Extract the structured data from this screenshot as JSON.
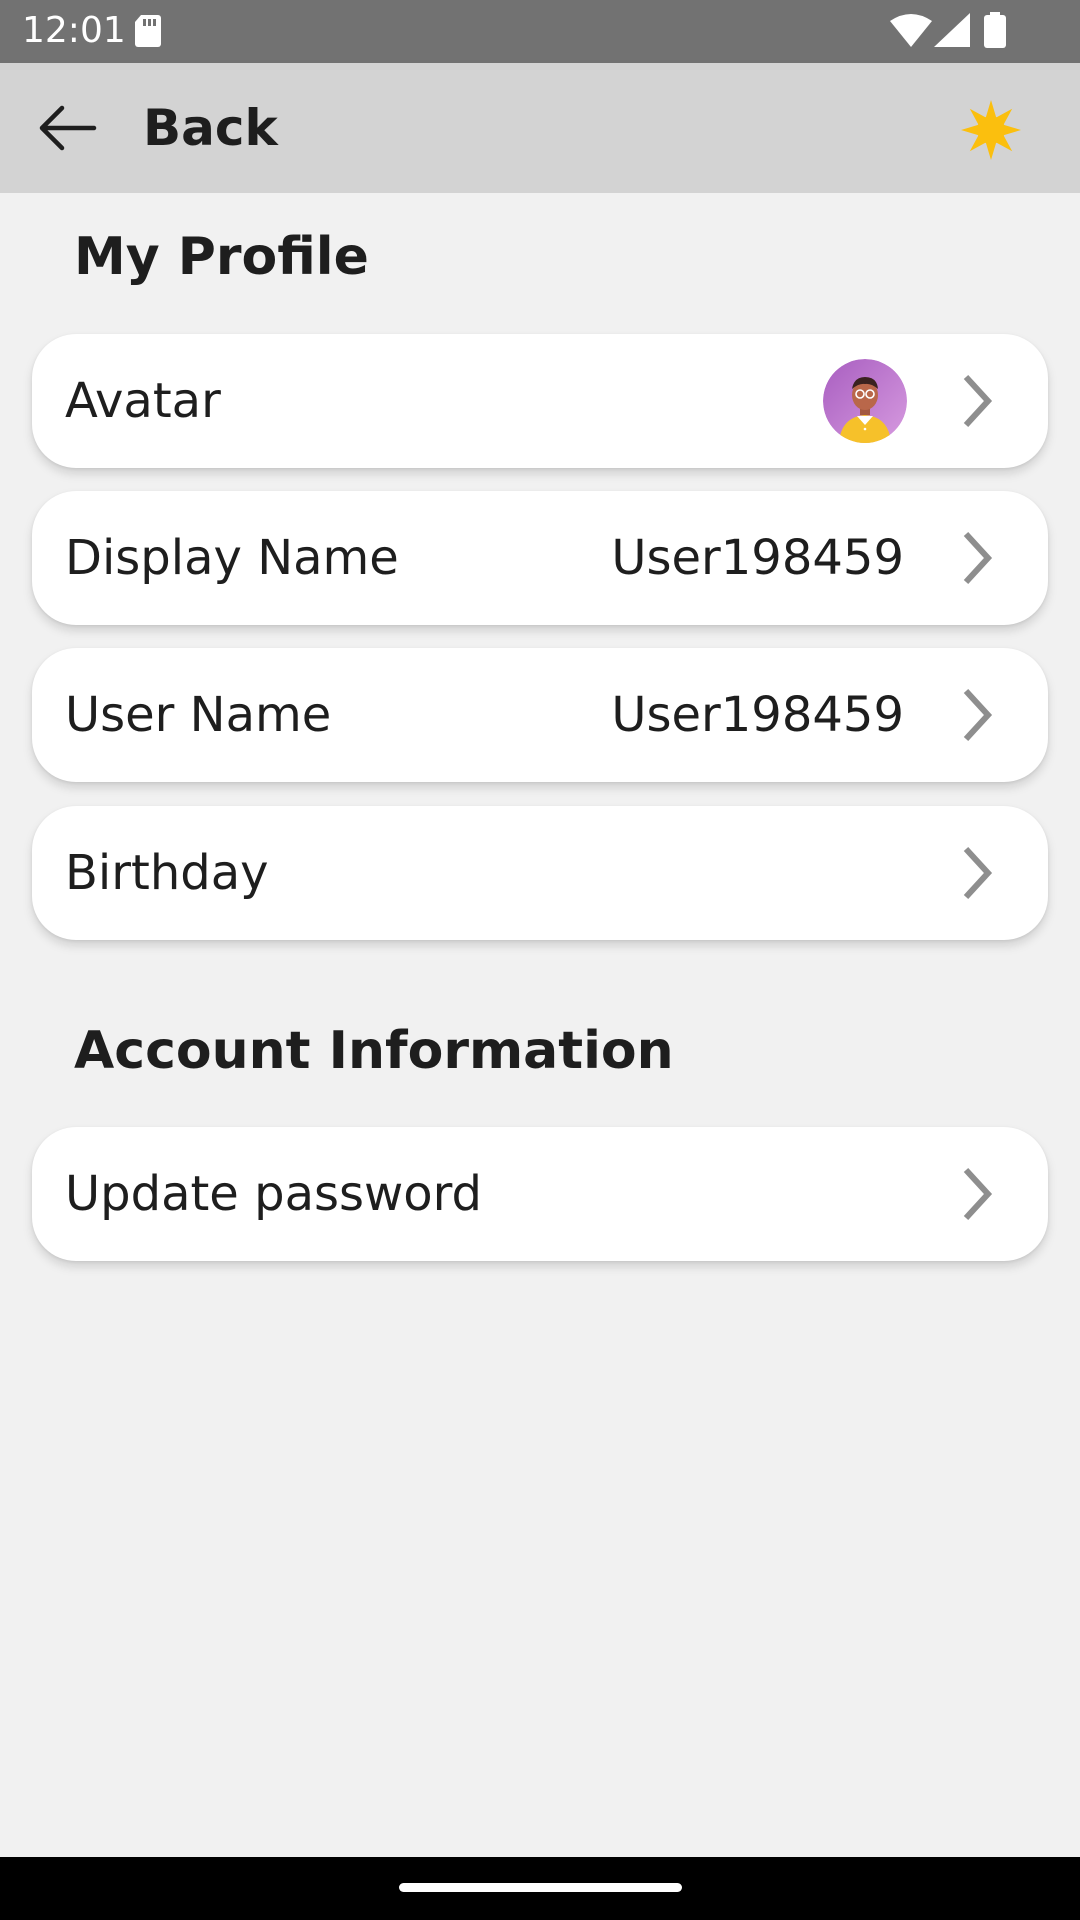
{
  "status_bar": {
    "time": "12:01",
    "icons": [
      "sd-card-icon",
      "wifi-icon",
      "signal-icon",
      "battery-icon"
    ]
  },
  "app_bar": {
    "back_label": "Back",
    "back_icon": "arrow-left-icon",
    "action_icon": "sun-icon",
    "accent_color": "#fbbf0e"
  },
  "profile": {
    "title": "My Profile",
    "items": [
      {
        "label": "Avatar",
        "value": "",
        "has_avatar": true
      },
      {
        "label": "Display Name",
        "value": "User198459"
      },
      {
        "label": "User Name",
        "value": "User198459"
      },
      {
        "label": "Birthday",
        "value": ""
      }
    ]
  },
  "account": {
    "title": "Account Information",
    "items": [
      {
        "label": "Update password",
        "value": ""
      }
    ]
  },
  "colors": {
    "background": "#f1f1f1",
    "card": "#ffffff",
    "app_bar": "#d3d3d3",
    "status_bar": "#727272",
    "chevron": "#8e8e8e",
    "avatar_bg": "#b56bc8"
  }
}
